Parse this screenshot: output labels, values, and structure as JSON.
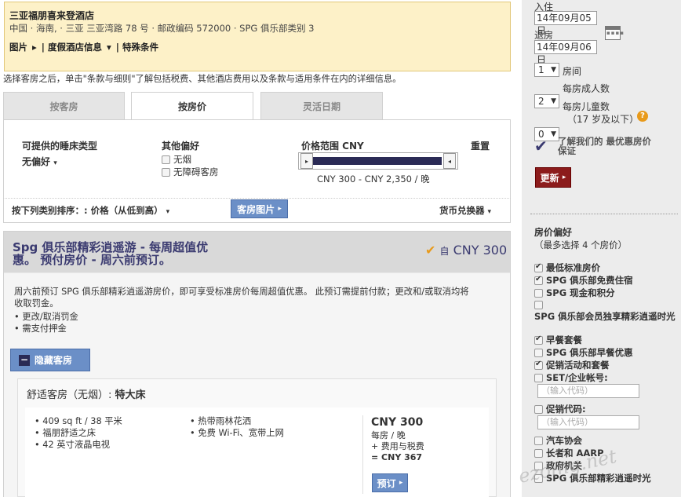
{
  "hotel": {
    "name": "三亚福朋喜来登酒店",
    "address": "中国 · 海南, · 三亚 三亚湾路 78 号 · 邮政编码 572000 · SPG 俱乐部类别 3",
    "links": [
      "图片",
      "度假酒店信息",
      "特殊条件"
    ]
  },
  "notice": "选择客房之后，单击\"条款与细则\"了解包括税费、其他酒店费用以及条款与适用条件在内的详细信息。",
  "tabs": [
    "按客房",
    "按房价",
    "灵活日期"
  ],
  "filters": {
    "bed_type_label": "可提供的睡床类型",
    "bed_type_value": "无偏好",
    "other_pref_label": "其他偏好",
    "other_prefs": [
      "无烟",
      "无障碍客房"
    ],
    "price_range_label": "价格范围 CNY",
    "reset_label": "重置",
    "price_range_text": "CNY 300 - CNY 2,350 / 晚"
  },
  "sort": {
    "label": "按下列类别排序：: 价格（从低到高）",
    "room_photos_btn": "客房图片",
    "currency_converter": "货币兑换器"
  },
  "offer": {
    "title_line1": "Spg 俱乐部精彩逍遥游 - 每周超值优",
    "title_line2": "惠。 预付房价 - 周六前预订。",
    "from_label": "自",
    "price": "CNY 300",
    "desc_line1": "周六前预订 SPG 俱乐部精彩逍遥游房价，即可享受标准房价每周超值优惠。 此预订需提前付款；更改和/或取消均将",
    "desc_line2": "收取罚金。",
    "bullets": [
      "更改/取消罚金",
      "需支付押金"
    ],
    "hide_rooms_label": "隐藏客房"
  },
  "room": {
    "title": "舒适客房（无烟）",
    "bed": "特大床",
    "features_col1": [
      "409 sq ft / 38 平米",
      "福朋舒适之床",
      "42 英寸液晶电视"
    ],
    "features_col2": [
      "热带雨林花洒",
      "免费 Wi-Fi、宽带上网"
    ],
    "price": "CNY 300",
    "per_night": "每房 / 晚",
    "fees": "+ 费用与税费",
    "total": "= CNY 367",
    "book_label": "预订"
  },
  "sidebar": {
    "checkin_label": "入住",
    "checkin_value": "14年09月05日",
    "checkout_label": "退房",
    "checkout_value": "14年09月06日",
    "rooms_value": "1",
    "rooms_label": "房间",
    "adults_value": "2",
    "adults_label": "每房成人数",
    "children_value": "0",
    "children_label": "每房儿童数",
    "children_note": "（17 岁及以下）",
    "guarantee_text": "了解我们的 最优惠房价保证",
    "update_label": "更新",
    "pref_title": "房价偏好",
    "pref_note": "（最多选择 4 个房价）",
    "prefs": [
      {
        "label": "最低标准房价",
        "checked": true
      },
      {
        "label": "SPG 俱乐部免费住宿",
        "checked": true
      },
      {
        "label": "SPG 现金和积分",
        "checked": false
      },
      {
        "label": "SPG 俱乐部会员独享精彩逍遥时光",
        "checked": false
      },
      {
        "label": "早餐套餐",
        "checked": true
      },
      {
        "label": "SPG 俱乐部早餐优惠",
        "checked": false
      },
      {
        "label": "促销活动和套餐",
        "checked": true
      },
      {
        "label": "SET/企业帐号:",
        "checked": false
      },
      {
        "label": "促销代码:",
        "checked": false
      },
      {
        "label": "汽车协会",
        "checked": false
      },
      {
        "label": "长者和 AARP",
        "checked": false
      },
      {
        "label": "政府机关",
        "checked": false
      },
      {
        "label": "SPG 俱乐部精彩逍遥时光",
        "checked": false
      }
    ],
    "code_placeholder": "（输入代码）"
  },
  "watermark": "ezoing.net",
  "colors": {
    "accent": "#3a3a70",
    "header_bg": "#fdf1c8",
    "button_blue": "#6b8fc7",
    "update_red": "#8c1c1c",
    "check_orange": "#e89a1b"
  }
}
